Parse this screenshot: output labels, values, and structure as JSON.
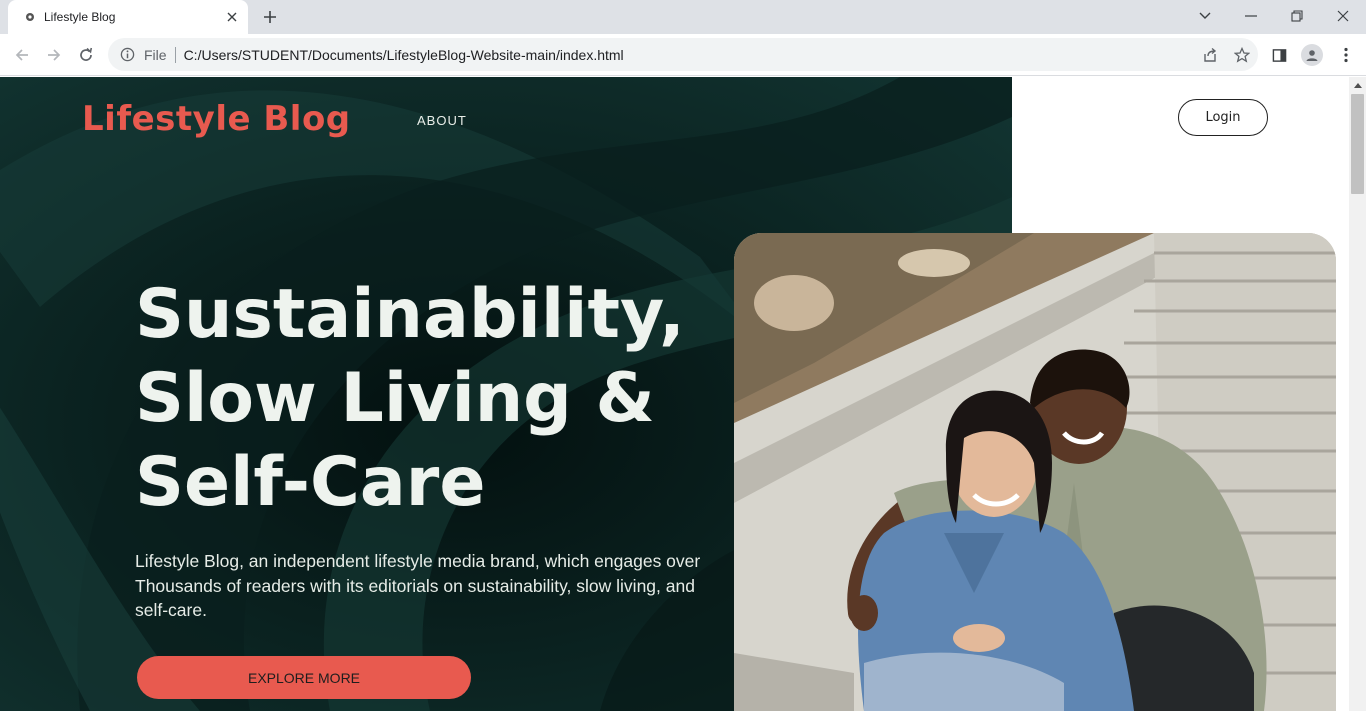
{
  "browser": {
    "tab_title": "Lifestyle Blog",
    "scheme_label": "File",
    "url": "C:/Users/STUDENT/Documents/LifestyleBlog-Website-main/index.html"
  },
  "site": {
    "brand": "Lifestyle Blog",
    "nav": [
      {
        "label": "ABOUT"
      }
    ],
    "login_label": "Login"
  },
  "hero": {
    "headline_lines": [
      "Sustainability,",
      "Slow Living &",
      "Self-Care"
    ],
    "description": "Lifestyle Blog, an independent lifestyle media brand, which engages over Thousands of readers with its editorials on sustainability, slow living, and self-care.",
    "cta_label": "EXPLORE MORE"
  },
  "colors": {
    "brand": "#e85a4f",
    "hero_bg": "#0d2624",
    "hero_text": "#eef3ee"
  },
  "icons": [
    "favicon-icon",
    "close-icon",
    "plus-icon",
    "chevron-down-icon",
    "minimize-icon",
    "restore-icon",
    "window-close-icon",
    "back-icon",
    "forward-icon",
    "reload-icon",
    "info-icon",
    "share-icon",
    "star-icon",
    "side-panel-icon",
    "profile-icon",
    "menu-icon"
  ]
}
